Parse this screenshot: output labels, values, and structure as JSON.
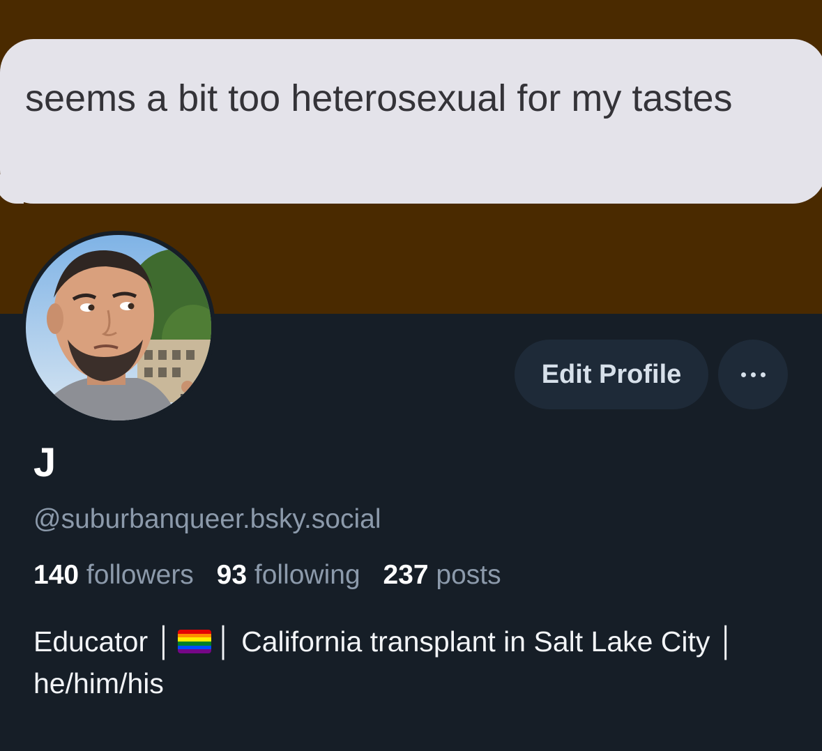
{
  "banner": {
    "background_color": "#4a2a00",
    "bubble_text": "seems a bit too heterosexual for my tastes"
  },
  "profile": {
    "avatar_alt": "profile photo",
    "edit_button_label": "Edit Profile",
    "more_button_icon": "ellipsis-icon",
    "display_name": "J",
    "handle": "@suburbanqueer.bsky.social",
    "stats": {
      "followers_count": "140",
      "followers_label": "followers",
      "following_count": "93",
      "following_label": "following",
      "posts_count": "237",
      "posts_label": "posts"
    },
    "bio": {
      "part1": "Educator │",
      "flag_icon": "rainbow-flag-icon",
      "part2": "│ California transplant in Salt Lake City │ he/him/his"
    }
  },
  "colors": {
    "background": "#161e27",
    "button_bg": "#1e2a38",
    "secondary_text": "#8c9aab",
    "primary_text": "#ffffff"
  }
}
